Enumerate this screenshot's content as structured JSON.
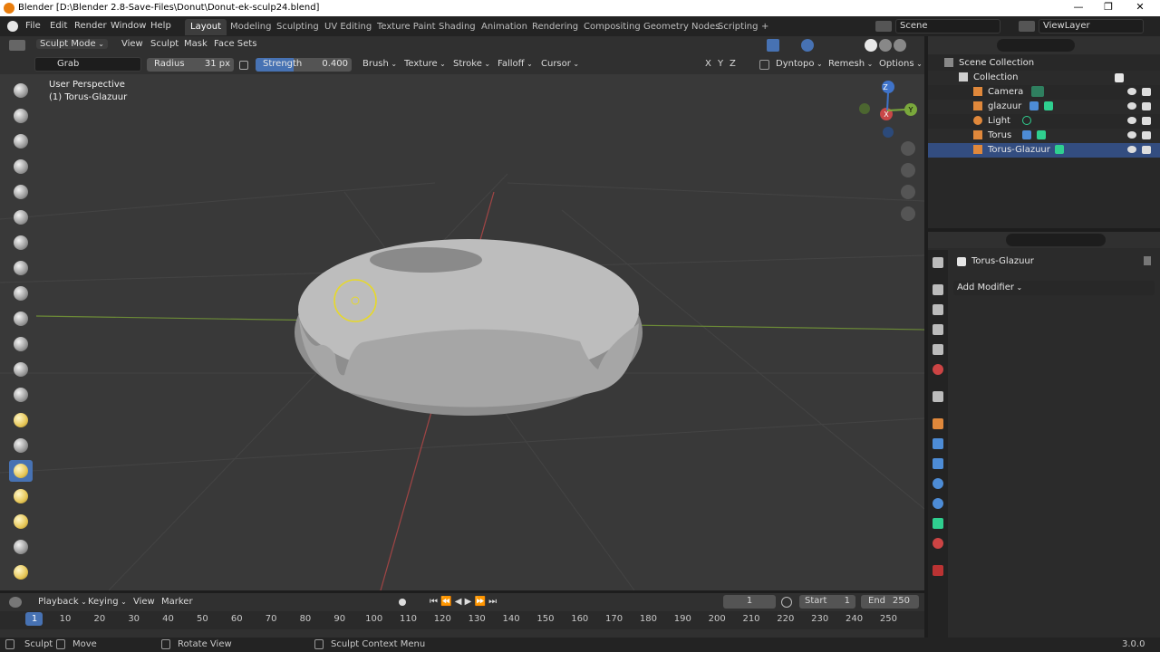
{
  "window": {
    "title": "Blender [D:\\Blender 2.8-Save-Files\\Donut\\Donut-ek-sculp24.blend]",
    "controls": [
      "—",
      "❐",
      "✕"
    ]
  },
  "menus": [
    "File",
    "Edit",
    "Render",
    "Window",
    "Help"
  ],
  "workspaces": [
    "Layout",
    "Modeling",
    "Sculpting",
    "UV Editing",
    "Texture Paint",
    "Shading",
    "Animation",
    "Rendering",
    "Compositing",
    "Geometry Nodes",
    "Scripting",
    "+"
  ],
  "scene": "Scene",
  "viewlayer": "ViewLayer",
  "header": {
    "mode": "Sculpt Mode",
    "items": [
      "View",
      "Sculpt",
      "Mask",
      "Face Sets"
    ]
  },
  "tool": {
    "brush": "Grab",
    "radius_label": "Radius",
    "radius_value": "31 px",
    "strength_label": "Strength",
    "strength_value": "0.400",
    "strength": 0.4,
    "menus": [
      "Brush",
      "Texture",
      "Stroke",
      "Falloff",
      "Cursor"
    ],
    "axes": [
      "X",
      "Y",
      "Z"
    ],
    "dyntopo": "Dyntopo",
    "remesh": "Remesh",
    "options": "Options"
  },
  "viewport": {
    "perspective": "User Perspective",
    "object": "(1) Torus-Glazuur"
  },
  "gizmo": {
    "z": "Z",
    "y": "Y",
    "x": "X"
  },
  "outliner": {
    "root": "Scene Collection",
    "collection": "Collection",
    "items": [
      "Camera",
      "glazuur",
      "Light",
      "Torus",
      "Torus-Glazuur"
    ]
  },
  "properties": {
    "object": "Torus-Glazuur",
    "add_modifier": "Add Modifier"
  },
  "timeline": {
    "menus": [
      "Playback",
      "Keying",
      "View",
      "Marker"
    ],
    "current": "1",
    "start_label": "Start",
    "start": "1",
    "end_label": "End",
    "end": "250",
    "ticks": [
      "1",
      "10",
      "20",
      "30",
      "40",
      "50",
      "60",
      "70",
      "80",
      "90",
      "100",
      "110",
      "120",
      "130",
      "140",
      "150",
      "160",
      "170",
      "180",
      "190",
      "200",
      "210",
      "220",
      "230",
      "240",
      "250"
    ]
  },
  "status": {
    "items": [
      "Sculpt",
      "Move",
      "Rotate View",
      "Sculpt Context Menu"
    ],
    "version": "3.0.0"
  },
  "colors": {
    "accent": "#4772b3",
    "brush_circle": "#e6d82c",
    "x_axis": "#c84747",
    "y_axis": "#7aa83c",
    "z_axis": "#3f73c9"
  }
}
